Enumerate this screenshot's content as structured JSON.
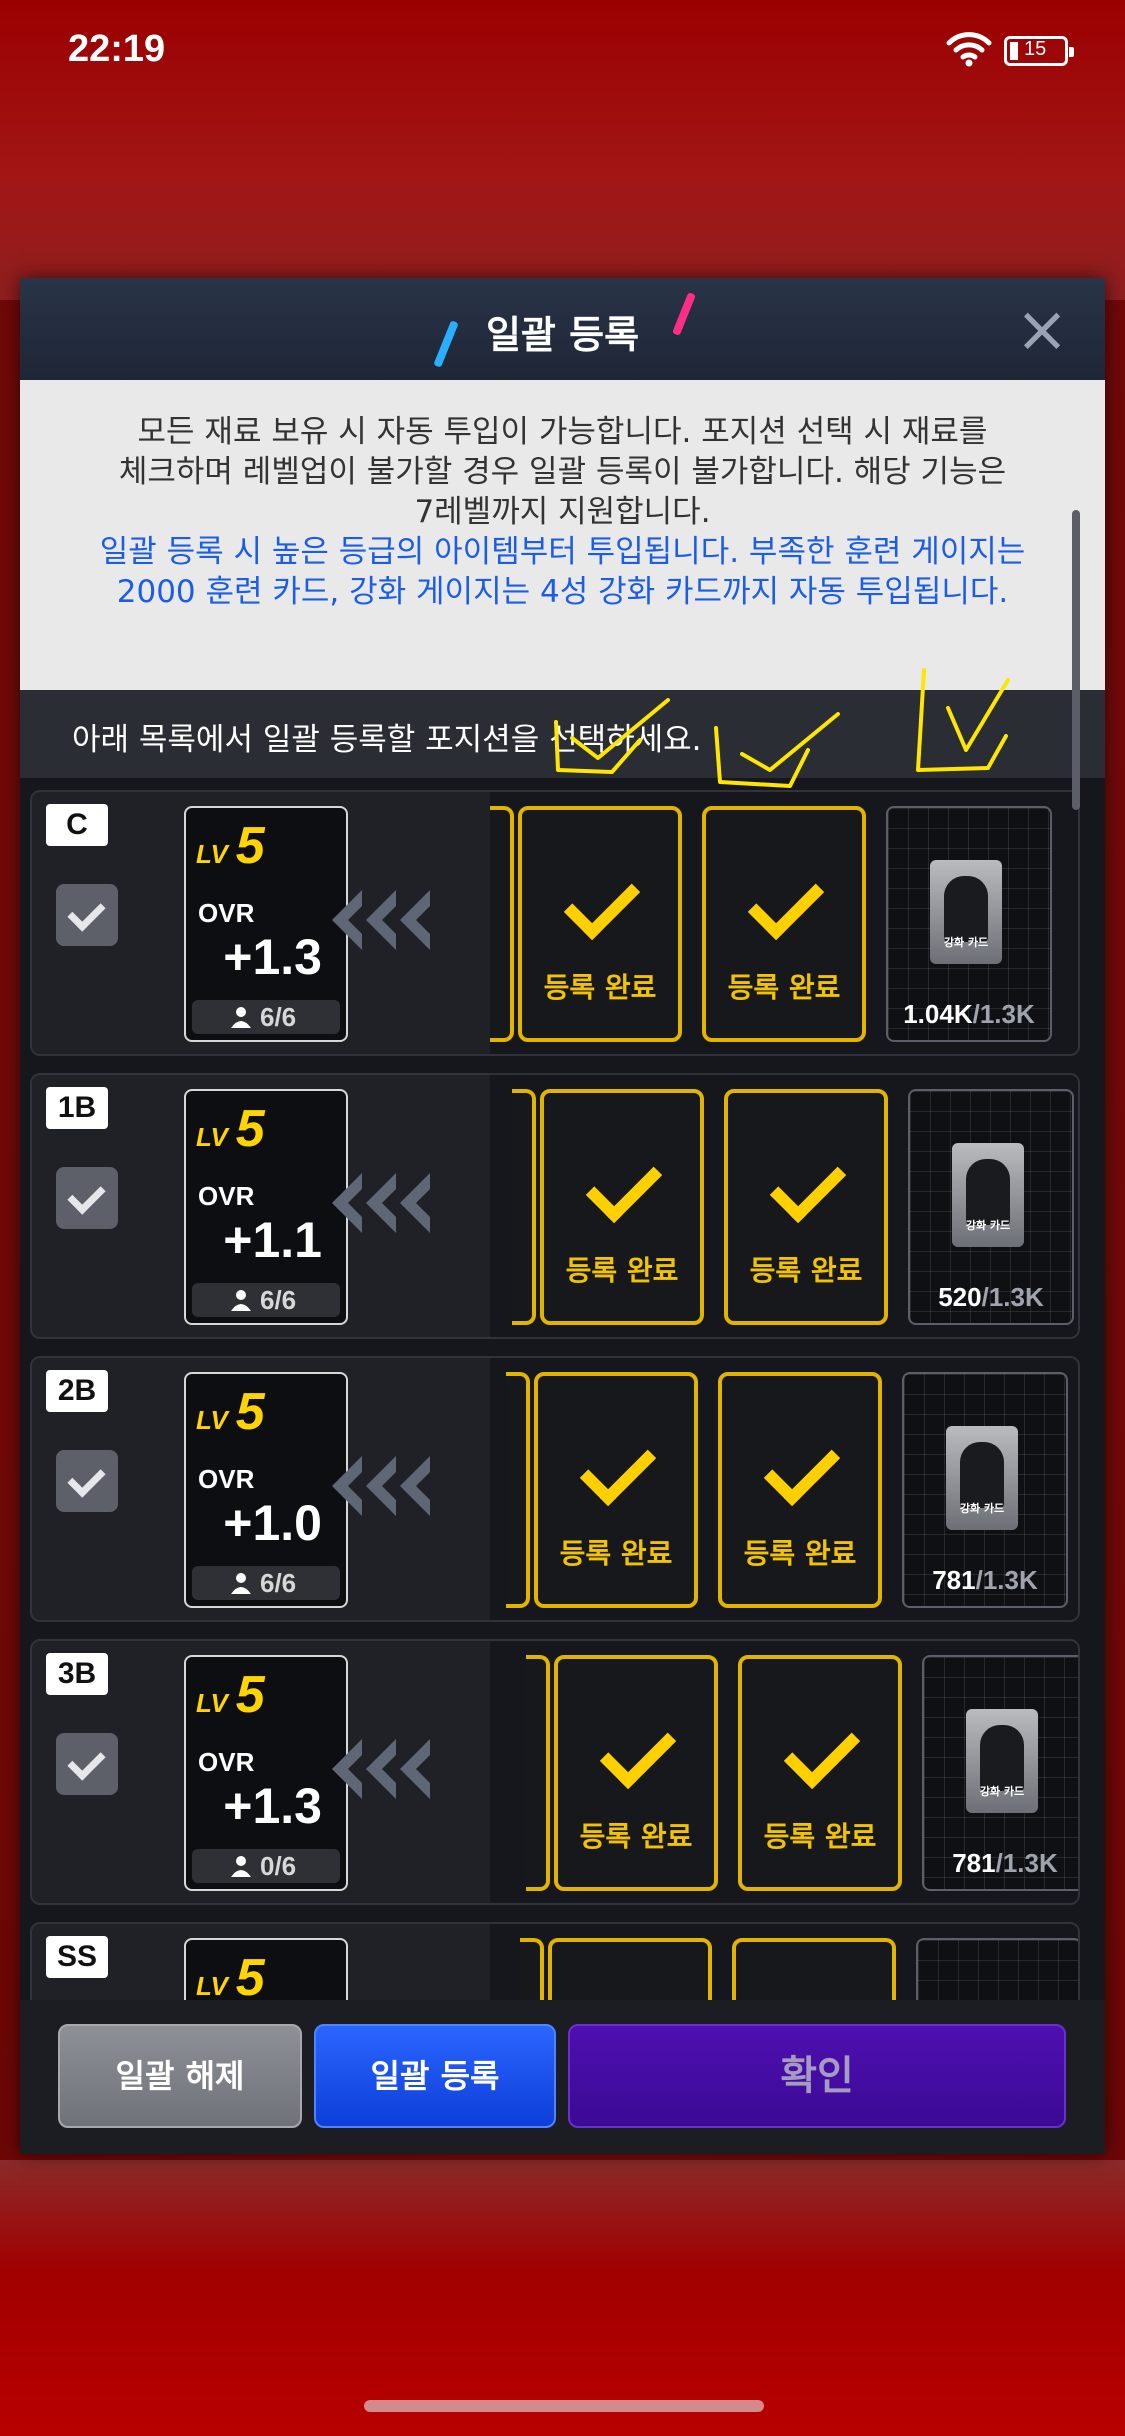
{
  "status_bar": {
    "time": "22:19",
    "battery_level": "15",
    "battery_fraction": 0.15
  },
  "modal": {
    "title": "일괄 등록",
    "close_icon": "close-icon",
    "notice_line_1": "모든 재료 보유 시 자동 투입이 가능합니다. 포지션 선택 시 재료를",
    "notice_line_2": "체크하며 레벨업이 불가할 경우 일괄 등록이 불가합니다. 해당 기능은",
    "notice_line_3": "7레벨까지 지원합니다.",
    "notice_blue_1": "일괄 등록 시 높은 등급의 아이템부터 투입됩니다. 부족한 훈련 게이지는",
    "notice_blue_2": "2000 훈련 카드, 강화 게이지는 4성 강화 카드까지 자동 투입됩니다.",
    "list_header": "아래 목록에서 일괄 등록할 포지션을 선택하세요.",
    "colors": {
      "accent_gold": "#ffd000",
      "header_bg": "#2a3448",
      "blue_text": "#1b5de6",
      "confirm_purple": "#4e0fb0"
    }
  },
  "rows": [
    {
      "position": "C",
      "checked": true,
      "lv_label": "LV",
      "level": "5",
      "ovr_label": "OVR",
      "ovr": "+1.3",
      "count": "6/6",
      "done_label_1": "등록 완료",
      "done_label_2": "등록 완료",
      "card_caption": "강화 카드",
      "enh_current": "1.04K",
      "enh_max": "/1.3K"
    },
    {
      "position": "1B",
      "checked": true,
      "lv_label": "LV",
      "level": "5",
      "ovr_label": "OVR",
      "ovr": "+1.1",
      "count": "6/6",
      "done_label_1": "등록 완료",
      "done_label_2": "등록 완료",
      "card_caption": "강화 카드",
      "enh_current": "520",
      "enh_max": "/1.3K"
    },
    {
      "position": "2B",
      "checked": true,
      "lv_label": "LV",
      "level": "5",
      "ovr_label": "OVR",
      "ovr": "+1.0",
      "count": "6/6",
      "done_label_1": "등록 완료",
      "done_label_2": "등록 완료",
      "card_caption": "강화 카드",
      "enh_current": "781",
      "enh_max": "/1.3K"
    },
    {
      "position": "3B",
      "checked": true,
      "lv_label": "LV",
      "level": "5",
      "ovr_label": "OVR",
      "ovr": "+1.3",
      "count": "0/6",
      "done_label_1": "등록 완료",
      "done_label_2": "등록 완료",
      "card_caption": "강화 카드",
      "enh_current": "781",
      "enh_max": "/1.3K"
    },
    {
      "position": "SS",
      "lv_label": "LV",
      "level": "5"
    }
  ],
  "footer": {
    "release_all_label": "일괄 해제",
    "register_all_label": "일괄 등록",
    "confirm_label": "확인"
  }
}
